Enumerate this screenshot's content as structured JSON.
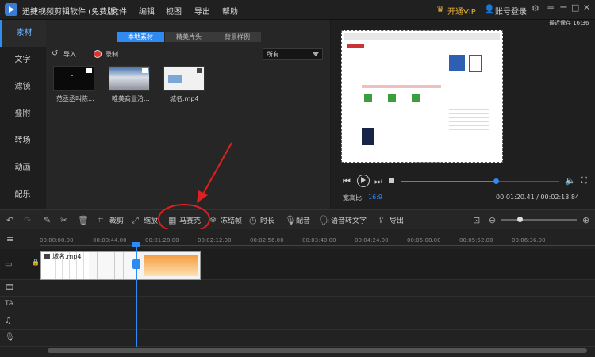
{
  "app": {
    "title": "迅捷视频剪辑软件 (免费版)"
  },
  "menu": [
    "文件",
    "编辑",
    "视图",
    "导出",
    "帮助"
  ],
  "top_right": {
    "vip": "开通VIP",
    "login": "账号登录",
    "save_status": "最近保存 16:36"
  },
  "sidebar": [
    "素材",
    "文字",
    "滤镜",
    "叠附",
    "转场",
    "动画",
    "配乐"
  ],
  "media": {
    "tabs": [
      "本地素材",
      "精美片头",
      "背景样例"
    ],
    "import": "导入",
    "record": "录制",
    "filter": "所有",
    "items": [
      {
        "label": "范丞丞叫陈..."
      },
      {
        "label": "唯美商业洽..."
      },
      {
        "label": "城名.mp4"
      }
    ]
  },
  "preview": {
    "aspect_label": "宽高比:",
    "aspect_value": "16:9",
    "time": "00:01:20.41 / 00:02:13.84",
    "progress": 0.6
  },
  "toolbar": [
    "裁剪",
    "缩放",
    "马赛克",
    "冻结帧",
    "时长",
    "配音",
    "语音转文字",
    "导出"
  ],
  "ruler": [
    "00:00:00.00",
    "00:00:44.00",
    "00:01:28.00",
    "00:02:12.00",
    "00:02:56.00",
    "00:03:40.00",
    "00:04:24.00",
    "00:05:08.00",
    "00:05:52.00",
    "00:06:36.00"
  ],
  "clip": {
    "name": "城名.mp4"
  },
  "colors": {
    "accent": "#2f8bf2",
    "annotation": "#e02020"
  }
}
